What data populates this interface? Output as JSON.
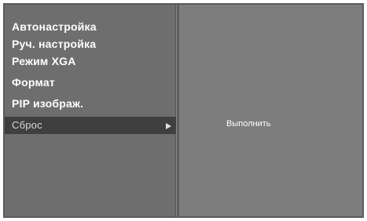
{
  "menu": {
    "items": [
      {
        "label": "Автонастройка"
      },
      {
        "label": "Руч. настройка"
      },
      {
        "label": "Режим XGA"
      },
      {
        "label": "Формат"
      },
      {
        "label": "PIP изображ."
      },
      {
        "label": "Сброс"
      }
    ]
  },
  "submenu": {
    "action_label": "Выполнить"
  },
  "icons": {
    "submenu_arrow": "triangle-right-icon"
  },
  "colors": {
    "panel_bg": "#6e6e6e",
    "submenu_bg": "#7d7d7d",
    "selected_bg": "#3f3f3f",
    "text": "#ffffff"
  }
}
